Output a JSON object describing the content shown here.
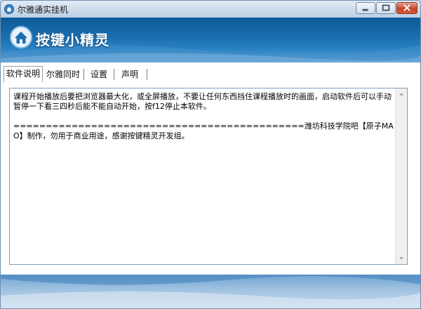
{
  "window": {
    "title": "尔雅通实挂机",
    "icon": "house-icon"
  },
  "banner": {
    "logo_icon": "house-logo-icon",
    "logo_text": "按键小精灵",
    "color": "#1b6fb0"
  },
  "tabs": [
    {
      "label": "软件说明",
      "active": true
    },
    {
      "label": "尔雅同时",
      "active": false
    },
    {
      "label": "设置",
      "active": false
    },
    {
      "label": "声明",
      "active": false
    }
  ],
  "content": {
    "text": "课程开始播放后要把浏览器最大化，或全屏播放，不要让任何东西挡住课程播放时的画面，启动软件后可以手动暂停一下看三四秒后能不能自动开始，按f12停止本软件。\n\n=============================================潍坊科技学院吧【原子MAO】制作，勿用于商业用途，感谢按键精灵开发组。"
  },
  "colors": {
    "close_button": "#c8452a",
    "window_border": "#6f8fb0"
  }
}
